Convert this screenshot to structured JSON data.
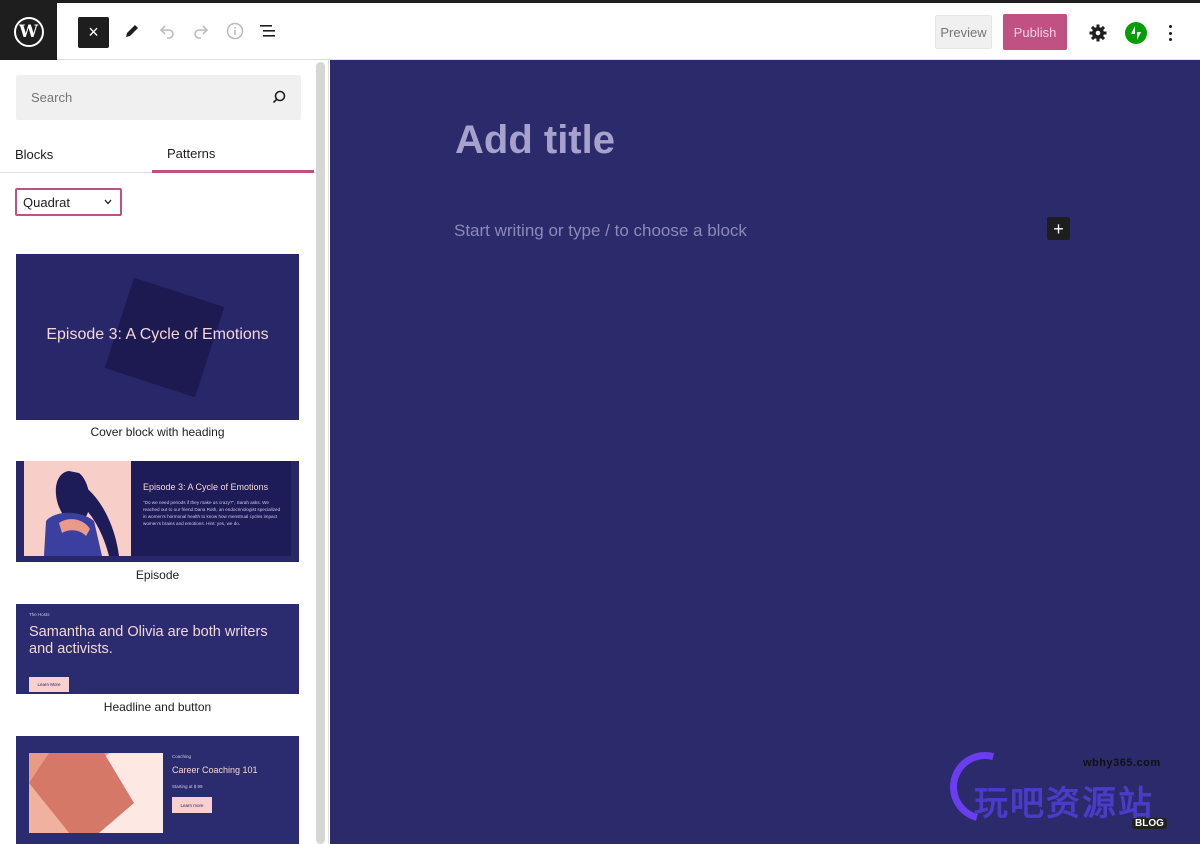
{
  "toolbar": {
    "close_icon": "×",
    "preview_label": "Preview",
    "publish_label": "Publish",
    "icons": [
      "wordpress-logo",
      "close-icon",
      "pencil-icon",
      "undo-icon",
      "redo-icon",
      "info-icon",
      "list-view-icon",
      "gear-icon",
      "jetpack-icon",
      "kebab-icon"
    ]
  },
  "sidebar": {
    "search_placeholder": "Search",
    "tabs": [
      {
        "label": "Blocks"
      },
      {
        "label": "Patterns",
        "active": true
      }
    ],
    "category_selected": "Quadrat",
    "patterns": [
      {
        "label": "Cover block with heading",
        "heading": "Episode 3: A Cycle of Emotions"
      },
      {
        "label": "Episode",
        "heading": "Episode 3: A Cycle of Emotions",
        "body": "\"Do we need periods if they make us crazy?\", Sarah asks. We reached out to our friend Dana Roth, an endocrinologist specialized in women's hormonal health to know how menstrual cycles impact women's brains and emotions. Hint: yes, we do."
      },
      {
        "label": "Headline and button",
        "eyebrow": "The Hosts",
        "heading": "Samantha and Olivia are both writers and activists.",
        "button": "Learn More"
      },
      {
        "label": "",
        "eyebrow": "Coaching",
        "heading": "Career Coaching 101",
        "sub": "Starting at $ 99",
        "button": "Learn more"
      }
    ]
  },
  "editor": {
    "title_placeholder": "Add title",
    "block_placeholder": "Start writing or type / to choose a block",
    "inserter_icon": "+"
  },
  "watermark": {
    "url": "wbhy365.com",
    "text": "玩吧资源站",
    "badge": "BLOG"
  },
  "colors": {
    "accent": "#c25183",
    "canvas_bg": "#2b2a6b",
    "dark": "#1e1e1e"
  }
}
